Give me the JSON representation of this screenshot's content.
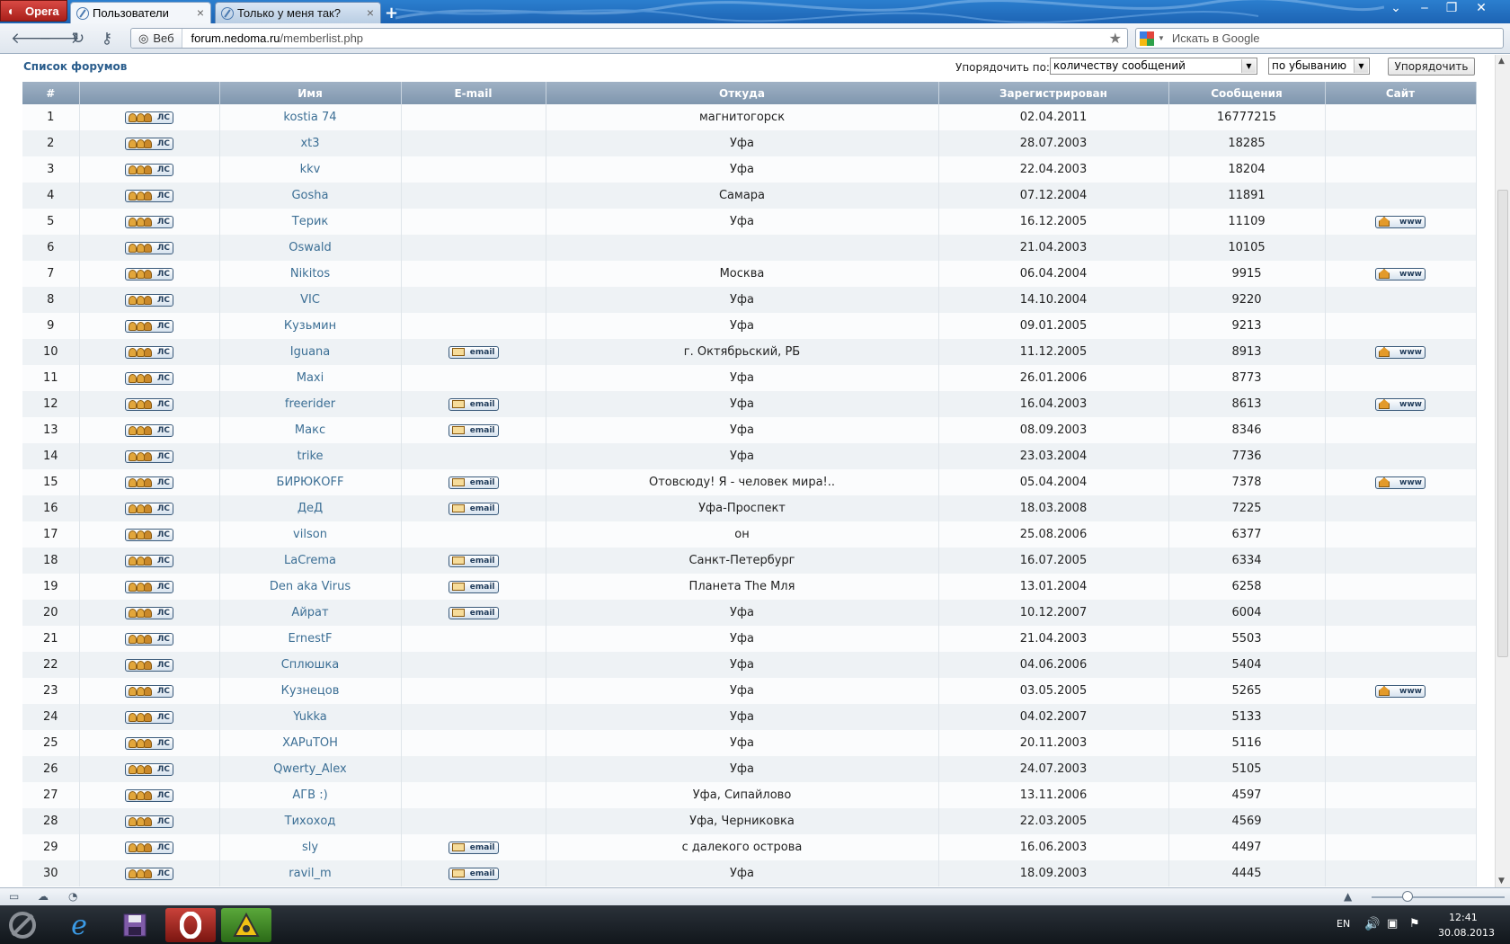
{
  "browser": {
    "menu_label": "Opera",
    "tabs": [
      {
        "title": "Пользователи"
      },
      {
        "title": "Только у меня так?"
      }
    ],
    "address": {
      "web_label": "Веб",
      "url_host": "forum.nedoma.ru",
      "url_path": "/memberlist.php"
    },
    "search_placeholder": "Искать в Google"
  },
  "page": {
    "forums_link": "Список форумов",
    "sort": {
      "label": "Упорядочить по:",
      "field_value": "количеству сообщений",
      "order_value": "по убыванию",
      "button": "Упорядочить"
    },
    "columns": [
      "#",
      "",
      "Имя",
      "E-mail",
      "Откуда",
      "Зарегистрирован",
      "Сообщения",
      "Сайт"
    ],
    "pm_label": "ЛС",
    "email_label": "email",
    "www_label": "www",
    "members": [
      {
        "n": "1",
        "name": "kostia 74",
        "email": false,
        "from": "магнитогорск",
        "reg": "02.04.2011",
        "posts": "16777215",
        "www": false
      },
      {
        "n": "2",
        "name": "xt3",
        "email": false,
        "from": "Уфа",
        "reg": "28.07.2003",
        "posts": "18285",
        "www": false
      },
      {
        "n": "3",
        "name": "kkv",
        "email": false,
        "from": "Уфа",
        "reg": "22.04.2003",
        "posts": "18204",
        "www": false
      },
      {
        "n": "4",
        "name": "Gosha",
        "email": false,
        "from": "Самара",
        "reg": "07.12.2004",
        "posts": "11891",
        "www": false
      },
      {
        "n": "5",
        "name": "Терик",
        "email": false,
        "from": "Уфа",
        "reg": "16.12.2005",
        "posts": "11109",
        "www": true
      },
      {
        "n": "6",
        "name": "Oswald",
        "email": false,
        "from": "",
        "reg": "21.04.2003",
        "posts": "10105",
        "www": false
      },
      {
        "n": "7",
        "name": "Nikitos",
        "email": false,
        "from": "Москва",
        "reg": "06.04.2004",
        "posts": "9915",
        "www": true
      },
      {
        "n": "8",
        "name": "VIC",
        "email": false,
        "from": "Уфа",
        "reg": "14.10.2004",
        "posts": "9220",
        "www": false
      },
      {
        "n": "9",
        "name": "Кузьмин",
        "email": false,
        "from": "Уфа",
        "reg": "09.01.2005",
        "posts": "9213",
        "www": false
      },
      {
        "n": "10",
        "name": "Iguana",
        "email": true,
        "from": "г. Октябрьский, РБ",
        "reg": "11.12.2005",
        "posts": "8913",
        "www": true
      },
      {
        "n": "11",
        "name": "Maxi",
        "email": false,
        "from": "Уфа",
        "reg": "26.01.2006",
        "posts": "8773",
        "www": false
      },
      {
        "n": "12",
        "name": "freerider",
        "email": true,
        "from": "Уфа",
        "reg": "16.04.2003",
        "posts": "8613",
        "www": true
      },
      {
        "n": "13",
        "name": "Макс",
        "email": true,
        "from": "Уфа",
        "reg": "08.09.2003",
        "posts": "8346",
        "www": false
      },
      {
        "n": "14",
        "name": "trike",
        "email": false,
        "from": "Уфа",
        "reg": "23.03.2004",
        "posts": "7736",
        "www": false
      },
      {
        "n": "15",
        "name": "БИРЮКOFF",
        "email": true,
        "from": "Отовсюду! Я - человек мира!..",
        "reg": "05.04.2004",
        "posts": "7378",
        "www": true
      },
      {
        "n": "16",
        "name": "ДеД",
        "email": true,
        "from": "Уфа-Проспект",
        "reg": "18.03.2008",
        "posts": "7225",
        "www": false
      },
      {
        "n": "17",
        "name": "vilson",
        "email": false,
        "from": "он",
        "reg": "25.08.2006",
        "posts": "6377",
        "www": false
      },
      {
        "n": "18",
        "name": "LaCrema",
        "email": true,
        "from": "Санкт-Петербург",
        "reg": "16.07.2005",
        "posts": "6334",
        "www": false
      },
      {
        "n": "19",
        "name": "Den aka Virus",
        "email": true,
        "from": "Планета The Мля",
        "reg": "13.01.2004",
        "posts": "6258",
        "www": false
      },
      {
        "n": "20",
        "name": "Айрат",
        "email": true,
        "from": "Уфа",
        "reg": "10.12.2007",
        "posts": "6004",
        "www": false
      },
      {
        "n": "21",
        "name": "ErnestF",
        "email": false,
        "from": "Уфа",
        "reg": "21.04.2003",
        "posts": "5503",
        "www": false
      },
      {
        "n": "22",
        "name": "Сплюшка",
        "email": false,
        "from": "Уфа",
        "reg": "04.06.2006",
        "posts": "5404",
        "www": false
      },
      {
        "n": "23",
        "name": "Кузнецов",
        "email": false,
        "from": "Уфа",
        "reg": "03.05.2005",
        "posts": "5265",
        "www": true
      },
      {
        "n": "24",
        "name": "Yukka",
        "email": false,
        "from": "Уфа",
        "reg": "04.02.2007",
        "posts": "5133",
        "www": false
      },
      {
        "n": "25",
        "name": "ХАРuТОН",
        "email": false,
        "from": "Уфа",
        "reg": "20.11.2003",
        "posts": "5116",
        "www": false
      },
      {
        "n": "26",
        "name": "Qwerty_Alex",
        "email": false,
        "from": "Уфа",
        "reg": "24.07.2003",
        "posts": "5105",
        "www": false
      },
      {
        "n": "27",
        "name": "АГВ :)",
        "email": false,
        "from": "Уфа, Сипайлово",
        "reg": "13.11.2006",
        "posts": "4597",
        "www": false
      },
      {
        "n": "28",
        "name": "Тихоход",
        "email": false,
        "from": "Уфа, Черниковка",
        "reg": "22.03.2005",
        "posts": "4569",
        "www": false
      },
      {
        "n": "29",
        "name": "sly",
        "email": true,
        "from": "с далекого острова",
        "reg": "16.06.2003",
        "posts": "4497",
        "www": false
      },
      {
        "n": "30",
        "name": "ravil_m",
        "email": true,
        "from": "Уфа",
        "reg": "18.09.2003",
        "posts": "4445",
        "www": false
      }
    ]
  },
  "taskbar": {
    "lang": "EN",
    "time": "12:41",
    "date": "30.08.2013"
  },
  "colors": {
    "header_bg": "#8ea3b9",
    "link": "#3c6f95",
    "row_alt": "#eef2f5"
  }
}
